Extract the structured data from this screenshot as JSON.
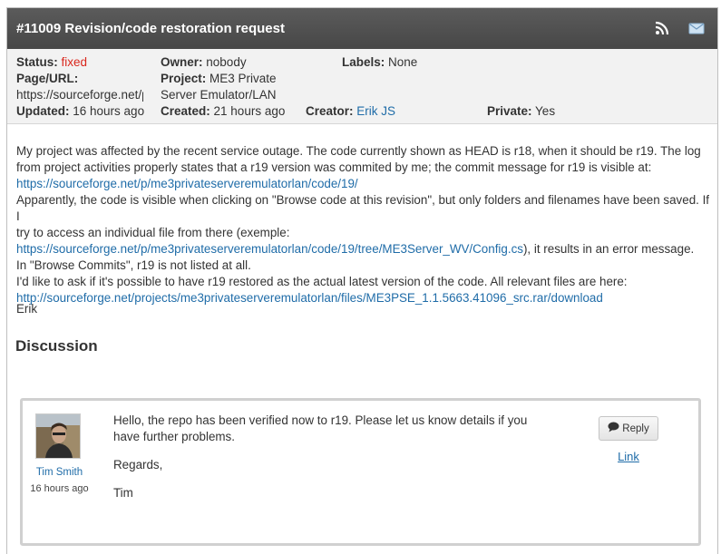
{
  "ticket": {
    "title": "#11009 Revision/code restoration request"
  },
  "meta": {
    "status_label": "Status:",
    "status_value": "fixed",
    "owner_label": "Owner:",
    "owner_value": "nobody",
    "labels_label": "Labels:",
    "labels_value": "None",
    "page_url_label": "Page/URL:",
    "page_url_value": "https://sourceforge.net/p",
    "project_label": "Project:",
    "project_value_line1": "ME3 Private",
    "project_value_line2": "Server Emulator/LAN",
    "updated_label": "Updated:",
    "updated_value": "16 hours ago",
    "created_label": "Created:",
    "created_value": "21 hours ago",
    "creator_label": "Creator:",
    "creator_value": "Erik JS",
    "private_label": "Private:",
    "private_value": "Yes"
  },
  "description": {
    "line1": "My project was affected by the recent service outage. The code currently shown as HEAD is r18, when it should be r19. The log",
    "line2": "from project activities properly states that a r19 version was commited by me; the commit message for r19 is visible at:",
    "link1": "https://sourceforge.net/p/me3privateserveremulatorlan/code/19/",
    "line3": "Apparently, the code is visible when clicking on \"Browse code at this revision\", but only folders and filenames have been saved. If I",
    "line4": "try to access an individual file from there (exemple:",
    "link2": "https://sourceforge.net/p/me3privateserveremulatorlan/code/19/tree/ME3Server_WV/Config.cs",
    "line5_suffix": "), it results in an error message.",
    "line6": "In \"Browse Commits\", r19 is not listed at all.",
    "line7": "I'd like to ask if it's possible to have r19 restored as the actual latest version of the code. All relevant files are here:",
    "link3": "http://sourceforge.net/projects/me3privateserveremulatorlan/files/ME3PSE_1.1.5663.41096_src.rar/download",
    "signature": "Erik"
  },
  "discussion": {
    "heading": "Discussion",
    "posts": [
      {
        "author": "Tim Smith",
        "time": "16 hours ago",
        "para1": "Hello, the repo has been verified now to r19. Please let us know details if you have further problems.",
        "para2": "Regards,",
        "para3": "Tim",
        "reply_label": "Reply",
        "link_label": "Link"
      }
    ]
  },
  "icons": {
    "rss": "rss-icon",
    "mail": "mail-icon",
    "comment": "comment-icon"
  }
}
